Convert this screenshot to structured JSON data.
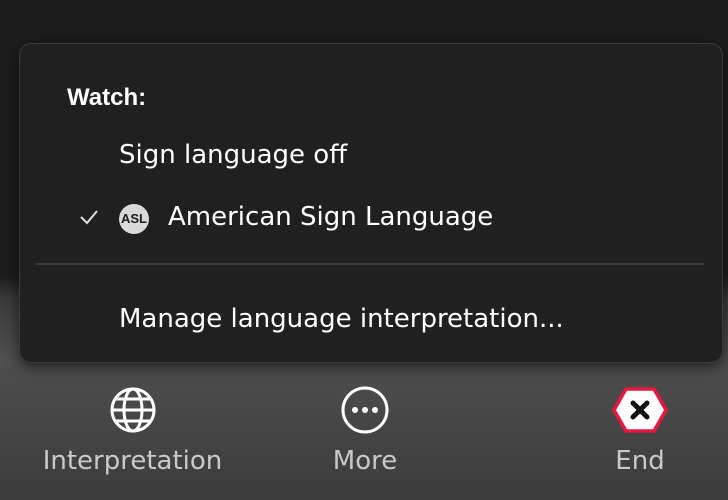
{
  "menu": {
    "heading": "Watch:",
    "items": [
      {
        "label": "Sign language off",
        "checked": false
      },
      {
        "label": "American Sign Language",
        "checked": true,
        "badge": "ASL"
      },
      {
        "label": "Manage language interpretation..."
      }
    ]
  },
  "toolbar": {
    "buttons": [
      {
        "label": "Interpretation",
        "icon": "globe-icon"
      },
      {
        "label": "More",
        "icon": "more-icon"
      },
      {
        "label": "End",
        "icon": "end-icon",
        "color": "#e8173e"
      }
    ]
  }
}
